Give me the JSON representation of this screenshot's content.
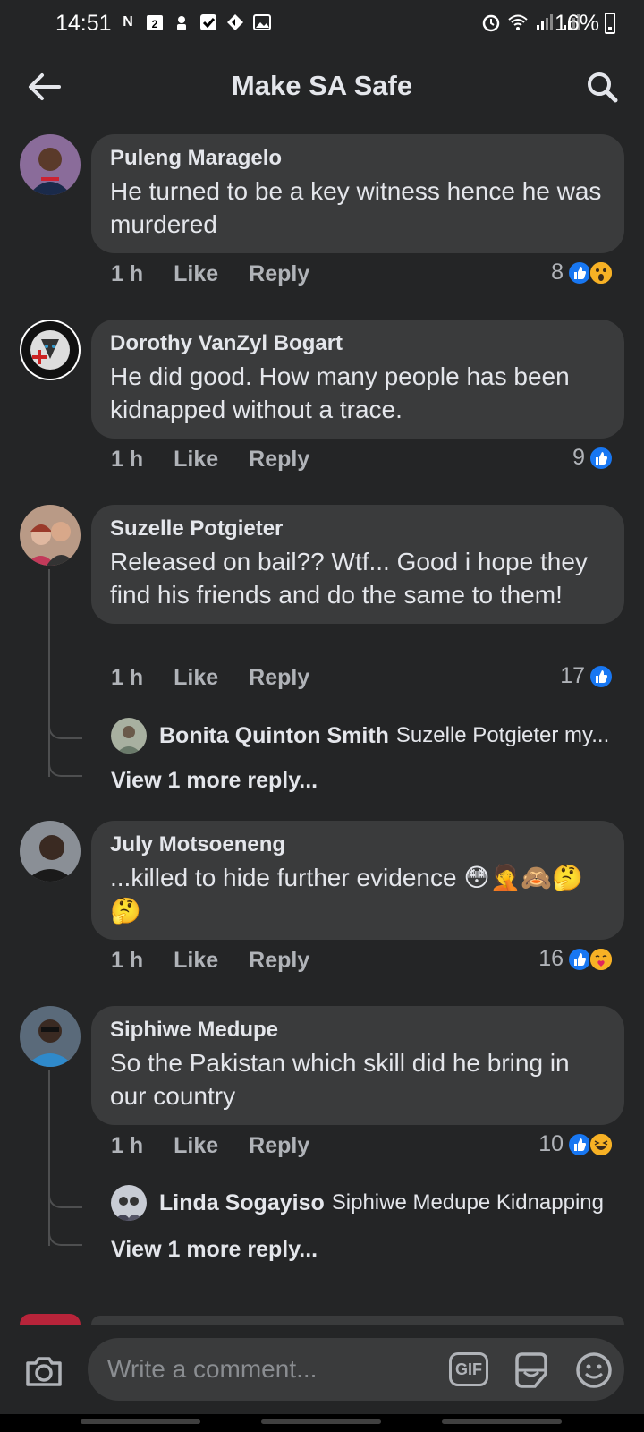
{
  "status_bar": {
    "time": "14:51",
    "battery": "16%",
    "notif_badge": "2"
  },
  "header": {
    "title": "Make SA Safe"
  },
  "comments": [
    {
      "author": "Puleng Maragelo",
      "text": "He turned to be a key witness hence he was murdered",
      "time": "1 h",
      "like_label": "Like",
      "reply_label": "Reply",
      "reaction_count": "8",
      "reactions": [
        "like-icon",
        "wow-icon"
      ],
      "avatar_color": "#6b4a7a"
    },
    {
      "author": "Dorothy VanZyl Bogart",
      "text": "He did good. How many people has been kidnapped without a trace.",
      "time": "1 h",
      "like_label": "Like",
      "reply_label": "Reply",
      "reaction_count": "9",
      "reactions": [
        "like-icon"
      ],
      "avatar_color": "#1a1a1a"
    },
    {
      "author": "Suzelle Potgieter",
      "text": "Released on bail?? Wtf... Good i hope they find his friends and do the same to them!",
      "time": "1 h",
      "like_label": "Like",
      "reply_label": "Reply",
      "reaction_count": "17",
      "reactions": [
        "like-icon"
      ],
      "avatar_color": "#8a6a5a",
      "reply_preview": {
        "author": "Bonita Quinton Smith",
        "text": "Suzelle Potgieter my...",
        "view_more": "View 1 more reply..."
      }
    },
    {
      "author": "July Motsoeneng",
      "text": "...killed to hide further evidence 😳🤦🙈🤔🤔",
      "time": "1 h",
      "like_label": "Like",
      "reply_label": "Reply",
      "reaction_count": "16",
      "reactions": [
        "like-icon",
        "care-icon"
      ],
      "avatar_color": "#3a2e28"
    },
    {
      "author": "Siphiwe Medupe",
      "text": "So the Pakistan which skill  did he bring in our country",
      "time": "1 h",
      "like_label": "Like",
      "reply_label": "Reply",
      "reaction_count": "10",
      "reactions": [
        "like-icon",
        "haha-icon"
      ],
      "avatar_color": "#2f5d8a",
      "reply_preview": {
        "author": "Linda Sogayiso",
        "text": "Siphiwe Medupe Kidnapping",
        "view_more": "View 1 more reply..."
      }
    }
  ],
  "composer": {
    "placeholder": "Write a comment...",
    "gif_label": "GIF"
  },
  "colors": {
    "background": "#242526",
    "bubble": "#3a3b3c",
    "like_blue": "#1877f2",
    "secondary_text": "#b0b3b8"
  }
}
